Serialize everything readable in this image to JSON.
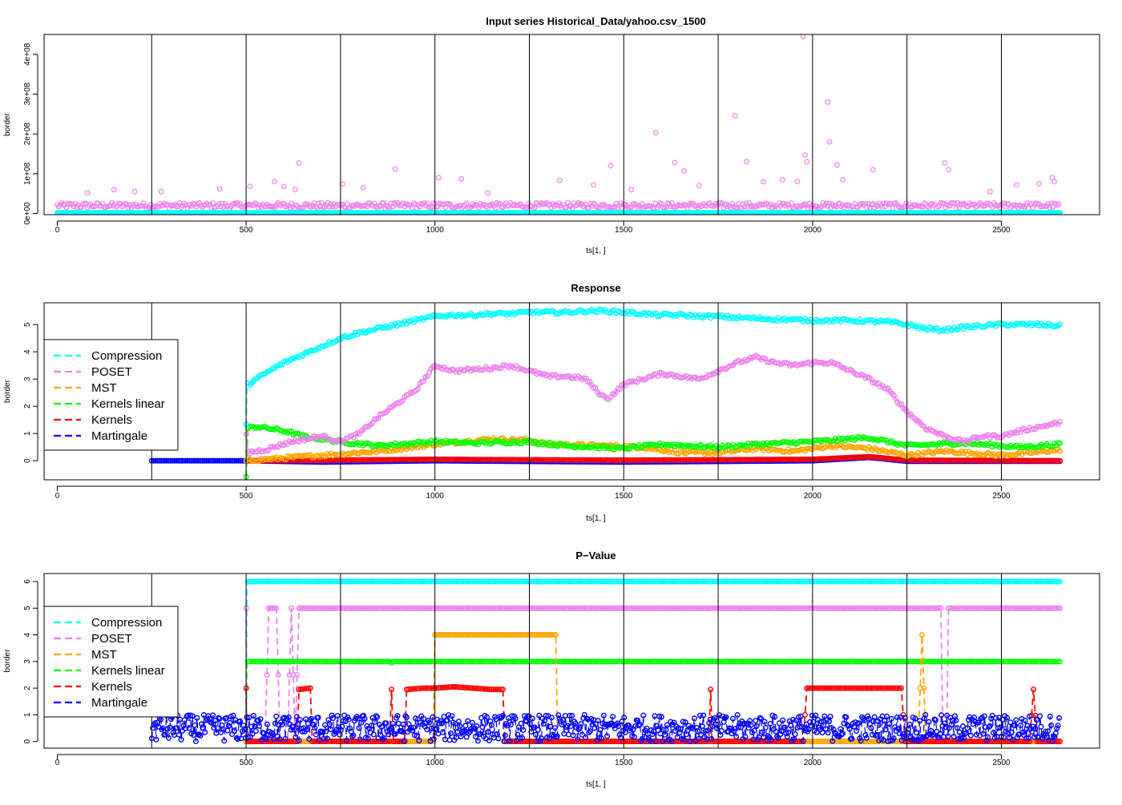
{
  "figure": {
    "colors": {
      "Compression": "#00ffff",
      "POSET": "#ee82ee",
      "MST": "#ffa500",
      "Kernels linear": "#00ff00",
      "Kernels": "#ff0000",
      "Martingale": "#0000ff"
    }
  },
  "chart_data": [
    {
      "type": "scatter",
      "title": "Input series Historical_Data/yahoo.csv_1500",
      "xlabel": "ts[1, ]",
      "ylabel": "border",
      "xlim": [
        -35,
        2760
      ],
      "ylim": [
        -3000000,
        450000000
      ],
      "x_ticks": [
        0,
        500,
        1000,
        1500,
        2000,
        2500
      ],
      "x_tick_labels": [
        "0",
        "500",
        "1000",
        "1500",
        "2000",
        "2500"
      ],
      "y_ticks": [
        0,
        100000000,
        200000000,
        300000000,
        400000000
      ],
      "y_tick_labels": [
        "0e+00",
        "1e+08",
        "2e+08",
        "3e+08",
        "4e+08"
      ],
      "vlines": [
        250,
        500,
        750,
        1000,
        1250,
        1500,
        1750,
        2000,
        2250,
        2500
      ],
      "grid": false,
      "series": [
        {
          "key": "POSET",
          "x_range": [
            0,
            2655
          ],
          "baseline": 20000000,
          "spread": 14000000,
          "spikes": [
            {
              "x": 80,
              "y": 52000000
            },
            {
              "x": 150,
              "y": 60000000
            },
            {
              "x": 205,
              "y": 55000000
            },
            {
              "x": 275,
              "y": 55000000
            },
            {
              "x": 430,
              "y": 62000000
            },
            {
              "x": 510,
              "y": 68000000
            },
            {
              "x": 575,
              "y": 80000000
            },
            {
              "x": 600,
              "y": 68000000
            },
            {
              "x": 630,
              "y": 60000000
            },
            {
              "x": 640,
              "y": 127000000
            },
            {
              "x": 755,
              "y": 74000000
            },
            {
              "x": 810,
              "y": 65000000
            },
            {
              "x": 895,
              "y": 112000000
            },
            {
              "x": 1010,
              "y": 90000000
            },
            {
              "x": 1070,
              "y": 87000000
            },
            {
              "x": 1140,
              "y": 52000000
            },
            {
              "x": 1330,
              "y": 83000000
            },
            {
              "x": 1420,
              "y": 72000000
            },
            {
              "x": 1465,
              "y": 120000000
            },
            {
              "x": 1520,
              "y": 60000000
            },
            {
              "x": 1585,
              "y": 203000000
            },
            {
              "x": 1635,
              "y": 128000000
            },
            {
              "x": 1660,
              "y": 107000000
            },
            {
              "x": 1700,
              "y": 70000000
            },
            {
              "x": 1795,
              "y": 246000000
            },
            {
              "x": 1825,
              "y": 130000000
            },
            {
              "x": 1870,
              "y": 80000000
            },
            {
              "x": 1920,
              "y": 85000000
            },
            {
              "x": 1960,
              "y": 80000000
            },
            {
              "x": 1975,
              "y": 445000000
            },
            {
              "x": 1980,
              "y": 147000000
            },
            {
              "x": 1985,
              "y": 130000000
            },
            {
              "x": 2040,
              "y": 280000000
            },
            {
              "x": 2045,
              "y": 180000000
            },
            {
              "x": 2065,
              "y": 122000000
            },
            {
              "x": 2080,
              "y": 85000000
            },
            {
              "x": 2160,
              "y": 110000000
            },
            {
              "x": 2350,
              "y": 127000000
            },
            {
              "x": 2360,
              "y": 110000000
            },
            {
              "x": 2470,
              "y": 55000000
            },
            {
              "x": 2540,
              "y": 72000000
            },
            {
              "x": 2600,
              "y": 75000000
            },
            {
              "x": 2635,
              "y": 90000000
            },
            {
              "x": 2640,
              "y": 80000000
            }
          ]
        },
        {
          "key": "Compression",
          "x_range": [
            0,
            2655
          ],
          "y": 1500000
        }
      ]
    },
    {
      "type": "line",
      "title": "Response",
      "xlabel": "ts[1, ]",
      "ylabel": "border",
      "xlim": [
        -35,
        2760
      ],
      "ylim": [
        -0.7,
        5.8
      ],
      "x_ticks": [
        0,
        500,
        1000,
        1500,
        2000,
        2500
      ],
      "x_tick_labels": [
        "0",
        "500",
        "1000",
        "1500",
        "2000",
        "2500"
      ],
      "y_ticks": [
        0,
        1,
        2,
        3,
        4,
        5
      ],
      "y_tick_labels": [
        "0",
        "1",
        "2",
        "3",
        "4",
        "5"
      ],
      "vlines": [
        250,
        500,
        750,
        1000,
        1250,
        1500,
        1750,
        2000,
        2250,
        2500
      ],
      "grid": false,
      "legend_position": "left",
      "legend": [
        "Compression",
        "POSET",
        "MST",
        "Kernels linear",
        "Kernels",
        "Martingale"
      ],
      "series": [
        {
          "name": "Martingale",
          "x": [
            250,
            500,
            700,
            1000,
            1500,
            2000,
            2150,
            2250,
            2655
          ],
          "y": [
            0,
            0,
            -0.05,
            0,
            -0.05,
            0,
            0.12,
            -0.02,
            -0.02
          ]
        },
        {
          "name": "Kernels",
          "x": [
            500,
            1000,
            1500,
            2000,
            2150,
            2250,
            2655
          ],
          "y": [
            0,
            0.05,
            0.02,
            0.05,
            0.15,
            0.02,
            0
          ]
        },
        {
          "name": "MST",
          "x": [
            500,
            550,
            650,
            750,
            850,
            1000,
            1150,
            1250,
            1300,
            1450,
            1550,
            1650,
            1750,
            1850,
            1950,
            2050,
            2150,
            2250,
            2350,
            2500,
            2655
          ],
          "y": [
            0,
            0.05,
            0.15,
            0.25,
            0.35,
            0.6,
            0.8,
            0.75,
            0.6,
            0.55,
            0.5,
            0.3,
            0.3,
            0.45,
            0.35,
            0.55,
            0.45,
            0.2,
            0.35,
            0.2,
            0.4
          ]
        },
        {
          "name": "Kernels linear",
          "x": [
            500,
            505,
            530,
            600,
            650,
            750,
            850,
            1000,
            1100,
            1250,
            1350,
            1500,
            1600,
            1750,
            1850,
            2000,
            2150,
            2250,
            2400,
            2550,
            2655
          ],
          "y": [
            -0.6,
            1.2,
            1.25,
            1.1,
            0.9,
            0.7,
            0.55,
            0.7,
            0.65,
            0.7,
            0.55,
            0.45,
            0.6,
            0.5,
            0.6,
            0.7,
            0.85,
            0.55,
            0.65,
            0.5,
            0.6
          ]
        },
        {
          "name": "POSET",
          "x": [
            500,
            505,
            550,
            620,
            700,
            750,
            800,
            850,
            900,
            950,
            1000,
            1050,
            1150,
            1200,
            1250,
            1300,
            1350,
            1400,
            1440,
            1460,
            1500,
            1600,
            1700,
            1750,
            1800,
            1850,
            1900,
            1950,
            2000,
            2050,
            2100,
            2150,
            2200,
            2250,
            2300,
            2350,
            2400,
            2450,
            2500,
            2550,
            2655
          ],
          "y": [
            1.0,
            0.3,
            0.4,
            0.7,
            0.9,
            0.7,
            1.0,
            1.6,
            2.1,
            2.6,
            3.5,
            3.3,
            3.4,
            3.5,
            3.3,
            3.1,
            3.1,
            3.0,
            2.4,
            2.3,
            2.8,
            3.2,
            3.0,
            3.3,
            3.6,
            3.8,
            3.6,
            3.5,
            3.6,
            3.6,
            3.3,
            3.0,
            2.6,
            1.8,
            1.2,
            0.9,
            0.7,
            0.9,
            0.9,
            1.1,
            1.4
          ]
        },
        {
          "name": "Compression",
          "x": [
            500,
            502,
            505,
            550,
            600,
            650,
            700,
            750,
            800,
            850,
            900,
            950,
            1000,
            1050,
            1100,
            1150,
            1200,
            1250,
            1300,
            1350,
            1400,
            1450,
            1500,
            1550,
            1600,
            1650,
            1700,
            1750,
            1800,
            1900,
            2000,
            2100,
            2200,
            2250,
            2300,
            2350,
            2400,
            2500,
            2600,
            2655
          ],
          "y": [
            1.3,
            2.7,
            2.8,
            3.2,
            3.6,
            3.9,
            4.2,
            4.5,
            4.7,
            4.85,
            5.0,
            5.15,
            5.3,
            5.35,
            5.35,
            5.4,
            5.4,
            5.45,
            5.45,
            5.45,
            5.5,
            5.5,
            5.45,
            5.4,
            5.35,
            5.35,
            5.3,
            5.3,
            5.25,
            5.2,
            5.15,
            5.15,
            5.1,
            5.0,
            4.85,
            4.8,
            4.9,
            5.0,
            5.0,
            4.95
          ]
        }
      ]
    },
    {
      "type": "line",
      "title": "P−Value",
      "xlabel": "ts[1, ]",
      "ylabel": "border",
      "xlim": [
        -35,
        2760
      ],
      "ylim": [
        -0.25,
        6.3
      ],
      "x_ticks": [
        0,
        500,
        1000,
        1500,
        2000,
        2500
      ],
      "x_tick_labels": [
        "0",
        "500",
        "1000",
        "1500",
        "2000",
        "2500"
      ],
      "y_ticks": [
        0,
        1,
        2,
        3,
        4,
        5,
        6
      ],
      "y_tick_labels": [
        "0",
        "1",
        "2",
        "3",
        "4",
        "5",
        "6"
      ],
      "vlines": [
        250,
        500,
        750,
        1000,
        1250,
        1500,
        1750,
        2000,
        2250,
        2500
      ],
      "grid": false,
      "legend_position": "left",
      "legend": [
        "Compression",
        "POSET",
        "MST",
        "Kernels linear",
        "Kernels",
        "Martingale"
      ],
      "series": [
        {
          "name": "Compression",
          "x": [
            500,
            502,
            2655
          ],
          "y": [
            0,
            6,
            6
          ]
        },
        {
          "name": "POSET",
          "x": [
            500,
            501,
            550,
            560,
            580,
            590,
            610,
            620,
            630,
            640,
            2340,
            2345,
            2355,
            2360,
            2655
          ],
          "y": [
            5,
            0,
            0,
            5,
            5,
            0,
            0,
            5,
            0,
            5,
            5,
            0,
            0,
            5,
            5
          ]
        },
        {
          "name": "Kernels linear",
          "x": [
            500,
            502,
            880,
            885,
            890,
            2655
          ],
          "y": [
            0,
            3,
            3,
            2.95,
            3,
            3
          ]
        },
        {
          "name": "MST",
          "x": [
            500,
            995,
            1000,
            1320,
            1325,
            2280,
            2290,
            2300,
            2310,
            2655
          ],
          "y": [
            0,
            0,
            4,
            4,
            0,
            0,
            4,
            0,
            0,
            0
          ]
        },
        {
          "name": "Kernels",
          "x": [
            500,
            501,
            635,
            640,
            670,
            675,
            880,
            885,
            890,
            920,
            925,
            970,
            1000,
            1050,
            1100,
            1150,
            1180,
            1185,
            1320,
            1325,
            1725,
            1730,
            1735,
            1975,
            1985,
            2050,
            2100,
            2150,
            2200,
            2235,
            2245,
            2575,
            2585,
            2595,
            2655
          ],
          "y": [
            2,
            0,
            0,
            1.95,
            2,
            0,
            0,
            1.95,
            0,
            0,
            1.95,
            2,
            2,
            2.05,
            2,
            1.95,
            1.95,
            0,
            0,
            0,
            0,
            1.95,
            0,
            0,
            2,
            2,
            2,
            2,
            2,
            2,
            0,
            0,
            1.95,
            0,
            0
          ]
        },
        {
          "name": "Martingale",
          "x_range": [
            250,
            2655
          ],
          "noise": [
            0,
            1
          ]
        }
      ]
    }
  ]
}
